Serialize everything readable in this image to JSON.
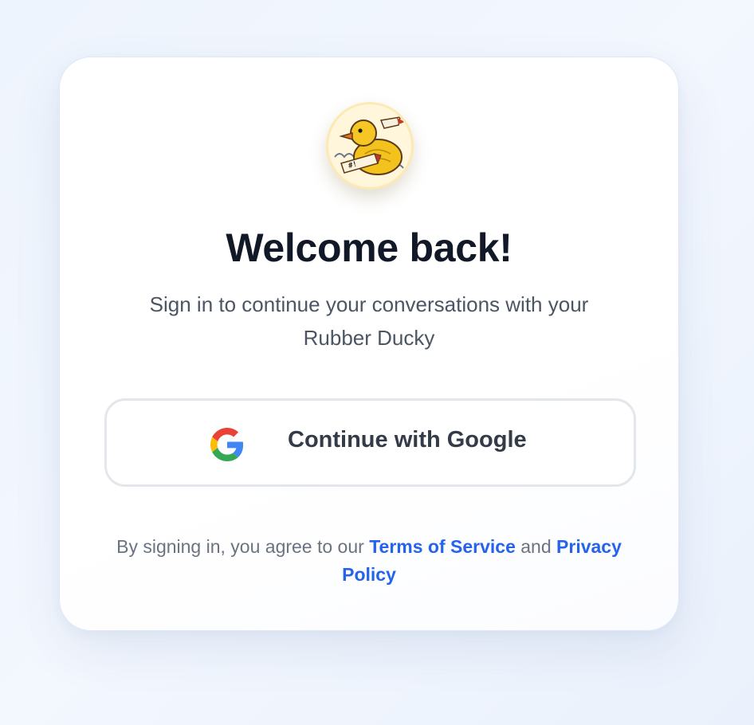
{
  "login": {
    "avatar_icon": "rubber-duck-logo",
    "title": "Welcome back!",
    "subtitle": "Sign in to continue your conversations with your Rubber Ducky",
    "google_button_label": "Continue with Google",
    "google_icon": "google-g-icon",
    "legal_prefix": "By signing in, you agree to our",
    "terms_link": "Terms of Service",
    "legal_and": "and",
    "privacy_link": "Privacy Policy"
  },
  "colors": {
    "background": "#eef4fd",
    "title": "#111827",
    "subtitle": "#4b5563",
    "link": "#2563eb",
    "button_border": "#e3e6ea"
  }
}
